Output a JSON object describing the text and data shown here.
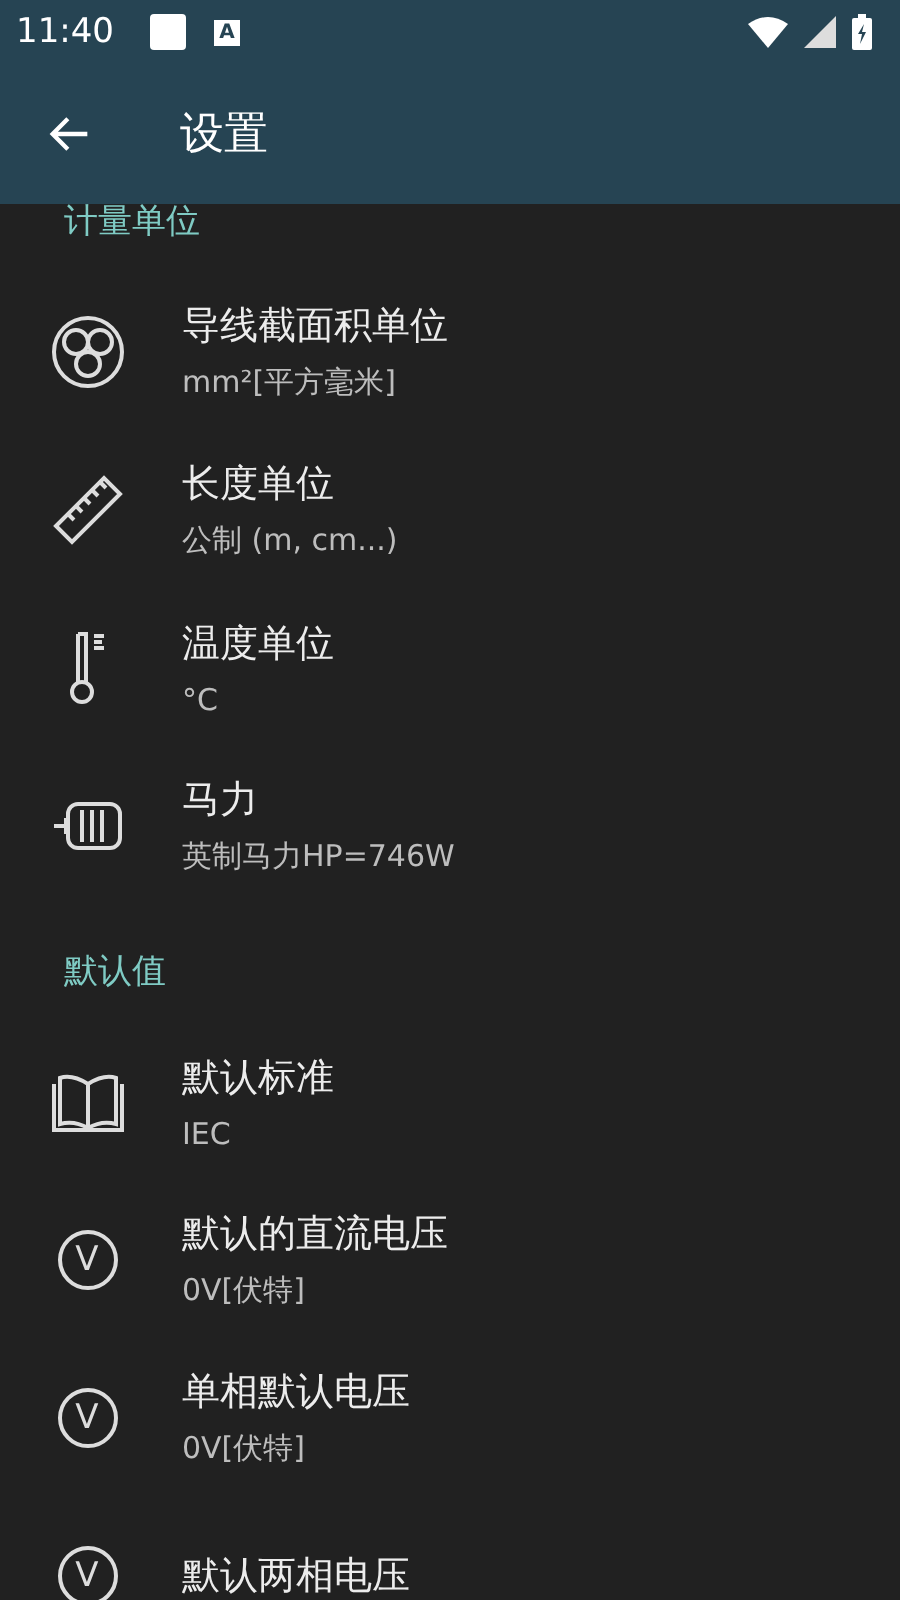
{
  "status_bar": {
    "time": "11:40",
    "notification_glyph": "A"
  },
  "app_bar": {
    "title": "设置"
  },
  "sections": [
    {
      "header": "计量单位",
      "items": [
        {
          "kind": "cable",
          "title": "导线截面积单位",
          "subtitle": "mm²[平方毫米]"
        },
        {
          "kind": "ruler",
          "title": "长度单位",
          "subtitle": "公制 (m, cm...)"
        },
        {
          "kind": "thermometer",
          "title": "温度单位",
          "subtitle": "°C"
        },
        {
          "kind": "motor",
          "title": "马力",
          "subtitle": "英制马力HP=746W"
        }
      ]
    },
    {
      "header": "默认值",
      "items": [
        {
          "kind": "book",
          "title": "默认标准",
          "subtitle": "IEC"
        },
        {
          "kind": "voltage",
          "icon_text": "V",
          "title": "默认的直流电压",
          "subtitle": "0V[伏特]"
        },
        {
          "kind": "voltage",
          "icon_text": "V",
          "title": "单相默认电压",
          "subtitle": "0V[伏特]"
        },
        {
          "kind": "voltage",
          "icon_text": "V",
          "title": "默认两相电压"
        }
      ]
    }
  ]
}
